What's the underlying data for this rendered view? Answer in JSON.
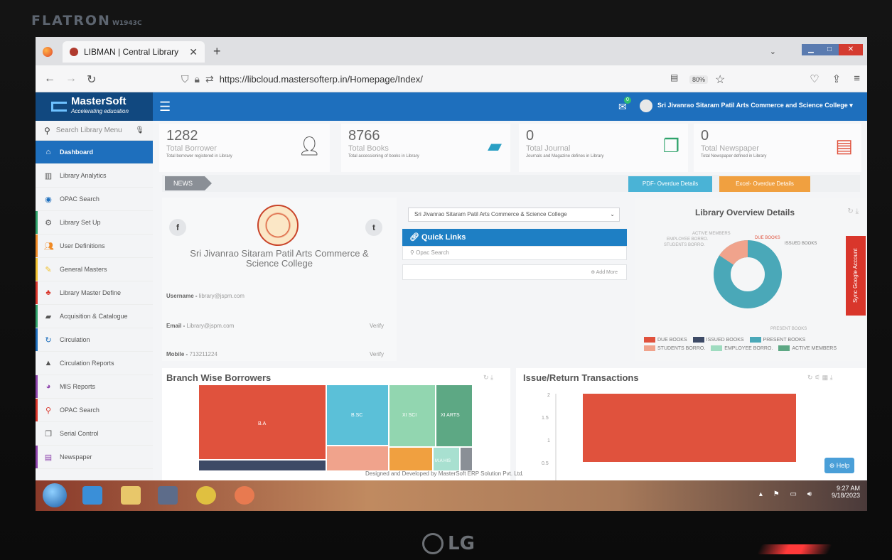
{
  "monitor": {
    "brand": "FLATRON",
    "model": "W1943C",
    "bottom_brand": "LG"
  },
  "browser": {
    "tab_title": "LIBMAN | Central Library",
    "url": "https://libcloud.mastersofterp.in/Homepage/Index/",
    "zoom": "80%"
  },
  "header": {
    "logo_main": "MasterSoft",
    "logo_sub": "Accelerating education",
    "institution": "Sri Jivanrao Sitaram Patil Arts Commerce and Science College ▾",
    "notification_count": "0"
  },
  "sidebar": {
    "search_placeholder": "Search Library Menu",
    "items": [
      {
        "label": "Dashboard",
        "icon": "home-icon"
      },
      {
        "label": "Library Analytics",
        "icon": "bar-chart-icon"
      },
      {
        "label": "OPAC Search",
        "icon": "globe-icon"
      },
      {
        "label": "Library Set Up",
        "icon": "gears-icon"
      },
      {
        "label": "User Definitions",
        "icon": "users-icon"
      },
      {
        "label": "General Masters",
        "icon": "edit-icon"
      },
      {
        "label": "Library Master Define",
        "icon": "sitemap-icon"
      },
      {
        "label": "Acquisition & Catalogue",
        "icon": "book-icon"
      },
      {
        "label": "Circulation",
        "icon": "refresh-icon"
      },
      {
        "label": "Circulation Reports",
        "icon": "picture-icon"
      },
      {
        "label": "MIS Reports",
        "icon": "pie-icon"
      },
      {
        "label": "OPAC Search",
        "icon": "search-icon"
      },
      {
        "label": "Serial Control",
        "icon": "copy-icon"
      },
      {
        "label": "Newspaper",
        "icon": "newspaper-icon"
      }
    ]
  },
  "stats": [
    {
      "value": "1282",
      "label": "Total Borrower",
      "sub": "Total borrower registered in Library"
    },
    {
      "value": "8766",
      "label": "Total Books",
      "sub": "Total accessioning of books in Library"
    },
    {
      "value": "0",
      "label": "Total Journal",
      "sub": "Journals and Magazine defines in Library"
    },
    {
      "value": "0",
      "label": "Total Newspaper",
      "sub": "Total Newspaper defined in Library"
    }
  ],
  "news": {
    "tag": "NEWS",
    "pdf_button": "PDF- Overdue Details",
    "excel_button": "Excel- Overdue Details"
  },
  "profile": {
    "college": "Sri Jivanrao Sitaram Patil Arts Commerce & Science College",
    "username_label": "Username - ",
    "username": "library@jspm.com",
    "email_label": "Email - ",
    "email": "Library@jspm.com",
    "mobile_label": "Mobile - ",
    "mobile": "713211224",
    "verify": "Verify"
  },
  "quick_links": {
    "college_select": "Sri Jivanrao Sitaram Patil Arts Commerce & Science College",
    "title": "Quick Links",
    "item": "Opac Search",
    "more": "Add More"
  },
  "overview": {
    "title": "Library Overview Details",
    "callouts": [
      "ACTIVE MEMBERS",
      "EMPLOYEE BORRO.",
      "STUDENTS BORRO.",
      "DUE BOOKS",
      "ISSUED BOOKS",
      "PRESENT BOOKS"
    ],
    "legend": [
      {
        "label": "DUE BOOKS",
        "color": "#e0523d"
      },
      {
        "label": "ISSUED BOOKS",
        "color": "#3d4a66"
      },
      {
        "label": "PRESENT BOOKS",
        "color": "#4aa8b8"
      },
      {
        "label": "STUDENTS BORRO.",
        "color": "#f0a38c"
      },
      {
        "label": "EMPLOYEE BORRO.",
        "color": "#9fdcc0"
      },
      {
        "label": "ACTIVE MEMBERS",
        "color": "#5da884"
      }
    ],
    "sync": "Sync Google Account"
  },
  "chart_data": [
    {
      "type": "treemap",
      "title": "Branch Wise Borrowers",
      "categories": [
        "B.A",
        "B.SC",
        "XI SCI",
        "XI ARTS",
        "M.A HIS"
      ],
      "colors": [
        "#e0523d",
        "#5bc0d8",
        "#92d6b0",
        "#5da884",
        "#a8e0d0"
      ]
    },
    {
      "type": "bar",
      "title": "Issue/Return Transactions",
      "yticks": [
        "2",
        "1.5",
        "1",
        "0.5"
      ]
    }
  ],
  "footer": "Designed and Developed by MasterSoft ERP Solution Pvt. Ltd.",
  "help": "Help",
  "taskbar": {
    "time": "9:27 AM",
    "date": "9/18/2023"
  }
}
